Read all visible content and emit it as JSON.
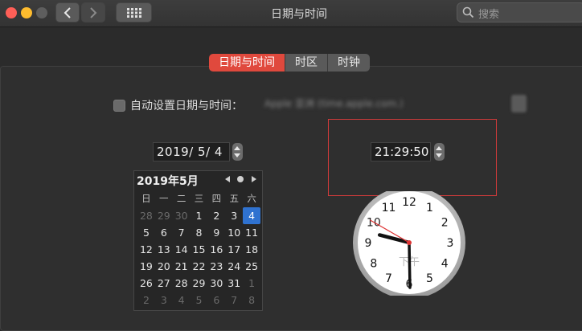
{
  "window": {
    "title": "日期与时间",
    "search_placeholder": "搜索"
  },
  "tabs": [
    {
      "label": "日期与时间",
      "active": true
    },
    {
      "label": "时区",
      "active": false
    },
    {
      "label": "时钟",
      "active": false
    }
  ],
  "auto_set": {
    "label": "自动设置日期与时间：",
    "checked": false,
    "server_value": "Apple 亚洲 (time.apple.com.)"
  },
  "date_field": {
    "value": "2019/  5/  4"
  },
  "time_field": {
    "value": "21:29:50"
  },
  "calendar": {
    "month_label": "2019年5月",
    "weekdays": [
      "日",
      "一",
      "二",
      "三",
      "四",
      "五",
      "六"
    ],
    "weeks": [
      [
        [
          "28",
          1
        ],
        [
          "29",
          1
        ],
        [
          "30",
          1
        ],
        [
          "1",
          0
        ],
        [
          "2",
          0
        ],
        [
          "3",
          0
        ],
        [
          "4",
          2
        ]
      ],
      [
        [
          "5",
          0
        ],
        [
          "6",
          0
        ],
        [
          "7",
          0
        ],
        [
          "8",
          0
        ],
        [
          "9",
          0
        ],
        [
          "10",
          0
        ],
        [
          "11",
          0
        ]
      ],
      [
        [
          "12",
          0
        ],
        [
          "13",
          0
        ],
        [
          "14",
          0
        ],
        [
          "15",
          0
        ],
        [
          "16",
          0
        ],
        [
          "17",
          0
        ],
        [
          "18",
          0
        ]
      ],
      [
        [
          "19",
          0
        ],
        [
          "20",
          0
        ],
        [
          "21",
          0
        ],
        [
          "22",
          0
        ],
        [
          "23",
          0
        ],
        [
          "24",
          0
        ],
        [
          "25",
          0
        ]
      ],
      [
        [
          "26",
          0
        ],
        [
          "27",
          0
        ],
        [
          "28",
          0
        ],
        [
          "29",
          0
        ],
        [
          "30",
          0
        ],
        [
          "31",
          0
        ],
        [
          "1",
          1
        ]
      ],
      [
        [
          "2",
          1
        ],
        [
          "3",
          1
        ],
        [
          "4",
          1
        ],
        [
          "5",
          1
        ],
        [
          "6",
          1
        ],
        [
          "7",
          1
        ],
        [
          "8",
          1
        ]
      ]
    ]
  },
  "clock": {
    "numbers": [
      "12",
      "1",
      "2",
      "3",
      "4",
      "5",
      "6",
      "7",
      "8",
      "9",
      "10",
      "11"
    ],
    "period_label": "下午",
    "hours": 21,
    "minutes": 29,
    "seconds": 50
  },
  "colors": {
    "accent_tab": "#e0493d",
    "selected_day": "#2f72d0",
    "highlight_box": "#d13b3b"
  }
}
